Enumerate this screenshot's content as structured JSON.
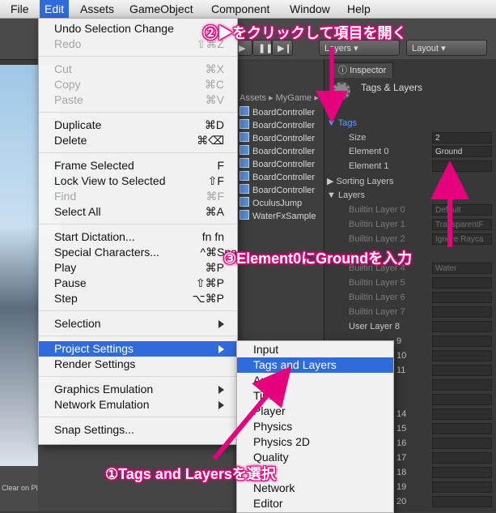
{
  "menubar": {
    "items": [
      {
        "label": "File"
      },
      {
        "label": "Edit"
      },
      {
        "label": "Assets"
      },
      {
        "label": "GameObject"
      },
      {
        "label": "Component"
      },
      {
        "label": "Window"
      },
      {
        "label": "Help"
      }
    ]
  },
  "edit_menu": {
    "items": [
      {
        "label": "Undo Selection Change",
        "shortcut": "⌘Z"
      },
      {
        "label": "Redo",
        "shortcut": "⇧⌘Z"
      },
      {
        "label": "Cut",
        "shortcut": "⌘X"
      },
      {
        "label": "Copy",
        "shortcut": "⌘C"
      },
      {
        "label": "Paste",
        "shortcut": "⌘V"
      },
      {
        "label": "Duplicate",
        "shortcut": "⌘D"
      },
      {
        "label": "Delete",
        "shortcut": "⌘⌫"
      },
      {
        "label": "Frame Selected",
        "shortcut": "F"
      },
      {
        "label": "Lock View to Selected",
        "shortcut": "⇧F"
      },
      {
        "label": "Find",
        "shortcut": "⌘F"
      },
      {
        "label": "Select All",
        "shortcut": "⌘A"
      },
      {
        "label": "Start Dictation...",
        "shortcut": "fn fn"
      },
      {
        "label": "Special Characters...",
        "shortcut": "^⌘Spa"
      },
      {
        "label": "Play",
        "shortcut": "⌘P"
      },
      {
        "label": "Pause",
        "shortcut": "⇧⌘P"
      },
      {
        "label": "Step",
        "shortcut": "⌥⌘P"
      },
      {
        "label": "Selection"
      },
      {
        "label": "Project Settings"
      },
      {
        "label": "Render Settings"
      },
      {
        "label": "Graphics Emulation"
      },
      {
        "label": "Network Emulation"
      },
      {
        "label": "Snap Settings..."
      }
    ]
  },
  "project_settings_submenu": {
    "items": [
      "Input",
      "Tags and Layers",
      "Audio",
      "Time",
      "Player",
      "Physics",
      "Physics 2D",
      "Quality",
      "Network",
      "Editor"
    ]
  },
  "toolbar": {
    "layers": "Layers",
    "layout": "Layout"
  },
  "project": {
    "breadcrumb": "Assets ▸ MyGame ▸",
    "items": [
      "BoardController",
      "BoardController",
      "BoardController",
      "BoardController",
      "BoardController",
      "BoardController",
      "BoardController",
      "OculusJump",
      "WaterFxSample"
    ]
  },
  "inspector": {
    "tab": "Inspector",
    "title": "Tags & Layers",
    "tags_header": "Tags",
    "size_label": "Size",
    "size_value": "2",
    "element0_label": "Element 0",
    "element0_value": "Ground",
    "element1_label": "Element 1",
    "element1_value": "",
    "sorting_layers": "Sorting Layers",
    "layers_header": "Layers",
    "builtin": [
      {
        "label": "Builtin Layer 0",
        "value": "Default"
      },
      {
        "label": "Builtin Layer 1",
        "value": "TransparentF"
      },
      {
        "label": "Builtin Layer 2",
        "value": "Ignore Rayca"
      },
      {
        "label": "Builtin Layer 4",
        "value": "Water"
      },
      {
        "label": "Builtin Layer 5",
        "value": ""
      },
      {
        "label": "Builtin Layer 6",
        "value": ""
      },
      {
        "label": "Builtin Layer 7",
        "value": ""
      }
    ],
    "user_layer_8": "User Layer 8",
    "row_numbers": [
      "9",
      "10",
      "11",
      "14",
      "15",
      "16",
      "17",
      "18",
      "19",
      "20"
    ]
  },
  "scene": {
    "clear_label": "Clear on Play"
  },
  "annotations": {
    "step1": "①Tags and Layersを選択",
    "step2": "②▶をクリックして項目を開く",
    "step3": "③Element0にGroundを入力"
  },
  "colors": {
    "highlight": "#2f6bda",
    "annotation": "#e6007e"
  }
}
